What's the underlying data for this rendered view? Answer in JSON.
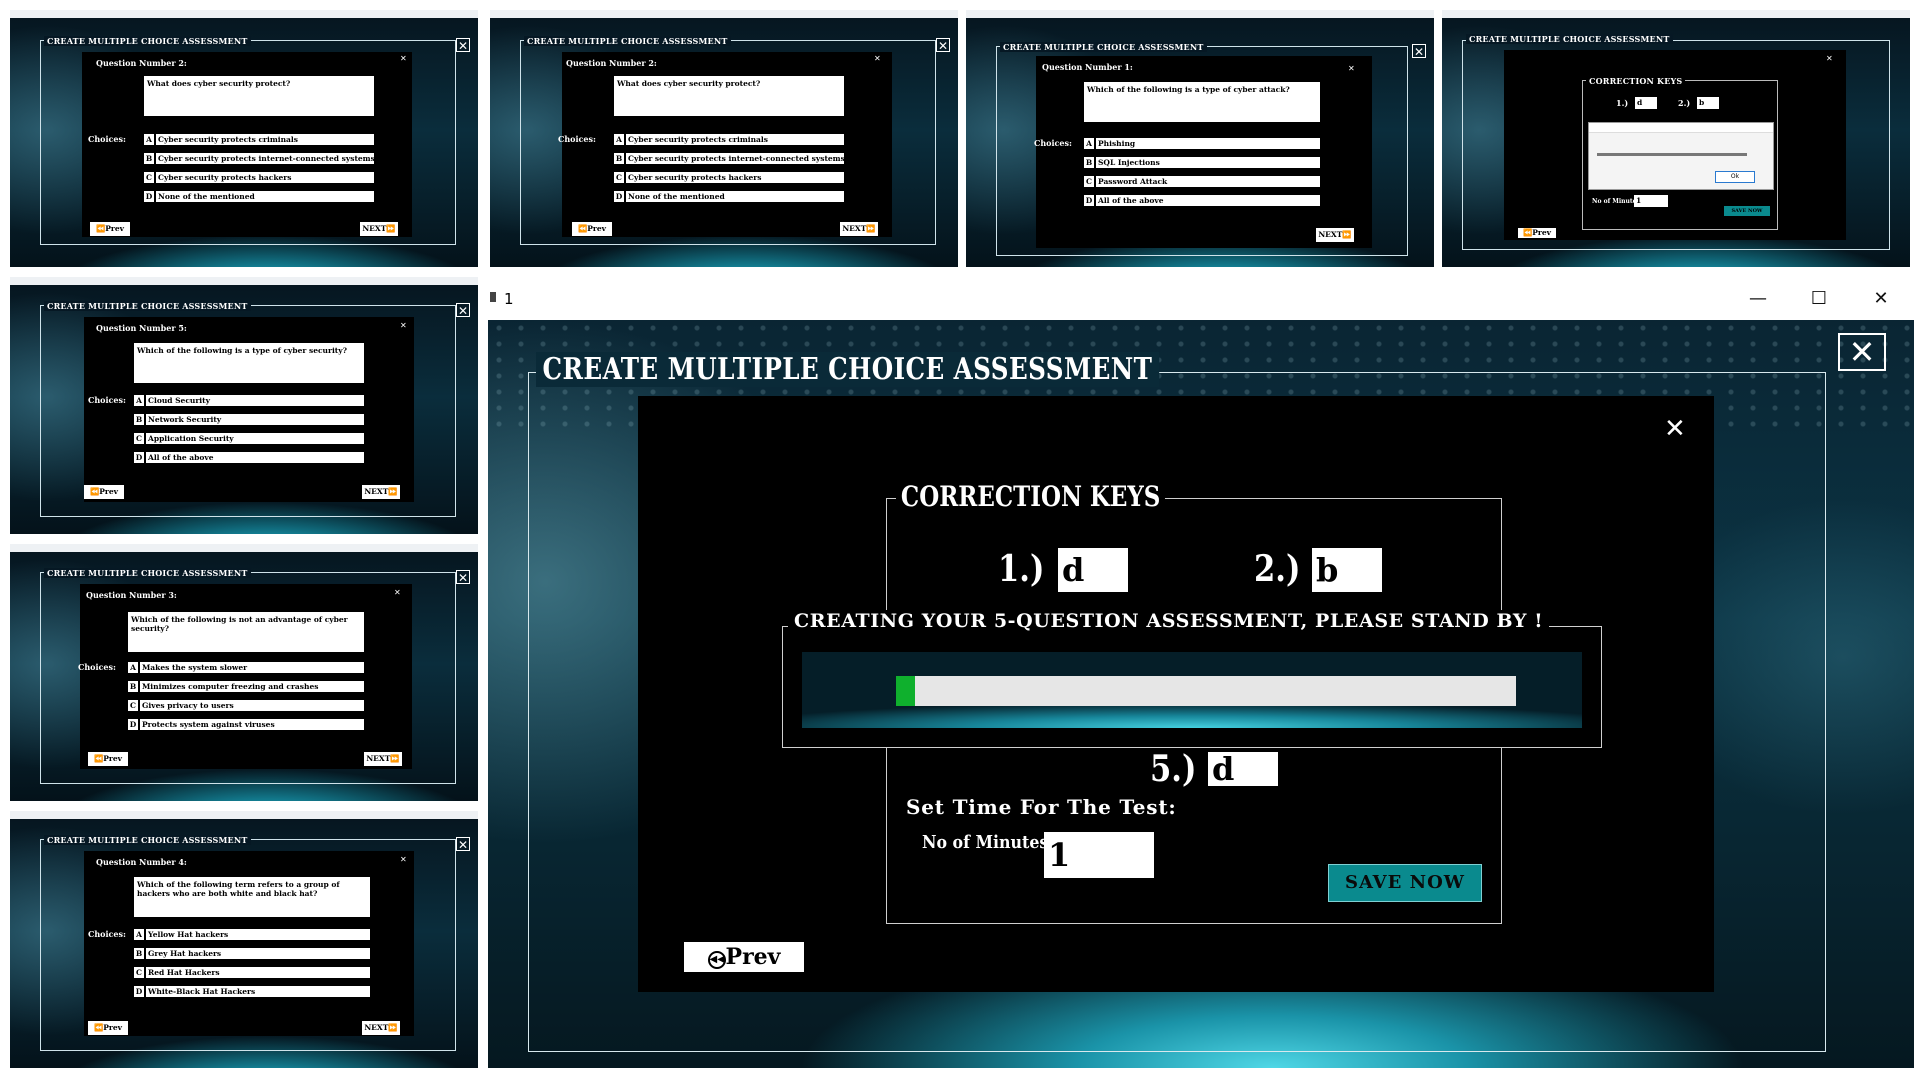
{
  "app": {
    "main_window_title": "1",
    "banner": "CREATE MULTIPLE CHOICE ASSESSMENT",
    "close_glyph": "✕"
  },
  "common": {
    "choices_label": "Choices:",
    "prev_label": "Prev",
    "next_label": "NEXT",
    "prev_icon": "rewind-icon",
    "next_icon": "fast-forward-icon"
  },
  "thumbs": [
    {
      "question_number": "Question Number 2:",
      "question": "What does cyber security protect?",
      "options": [
        {
          "letter": "A",
          "text": "Cyber security protects criminals"
        },
        {
          "letter": "B",
          "text": "Cyber security protects internet-connected systems"
        },
        {
          "letter": "C",
          "text": "Cyber security protects hackers"
        },
        {
          "letter": "D",
          "text": "None of the mentioned"
        }
      ]
    },
    {
      "question_number": "Question Number 2:",
      "question": "What does cyber security protect?",
      "options": [
        {
          "letter": "A",
          "text": "Cyber security protects criminals"
        },
        {
          "letter": "B",
          "text": "Cyber security protects internet-connected systems"
        },
        {
          "letter": "C",
          "text": "Cyber security protects hackers"
        },
        {
          "letter": "D",
          "text": "None of the mentioned"
        }
      ]
    },
    {
      "question_number": "Question Number 1:",
      "question": "Which of the following is a type of cyber attack?",
      "options": [
        {
          "letter": "A",
          "text": "Phishing"
        },
        {
          "letter": "B",
          "text": "SQL Injections"
        },
        {
          "letter": "C",
          "text": "Password Attack"
        },
        {
          "letter": "D",
          "text": "All of the above"
        }
      ]
    },
    {
      "question_number": "Question Number 5:",
      "question": "Which of the following is a type of cyber security?",
      "options": [
        {
          "letter": "A",
          "text": "Cloud Security"
        },
        {
          "letter": "B",
          "text": "Network Security"
        },
        {
          "letter": "C",
          "text": "Application Security"
        },
        {
          "letter": "D",
          "text": "All of the above"
        }
      ]
    },
    {
      "question_number": "Question Number 3:",
      "question": "Which of the following is not an advantage of cyber security?",
      "options": [
        {
          "letter": "A",
          "text": "Makes the system slower"
        },
        {
          "letter": "B",
          "text": "Minimizes computer freezing and crashes"
        },
        {
          "letter": "C",
          "text": "Gives privacy to users"
        },
        {
          "letter": "D",
          "text": "Protects system against viruses"
        }
      ]
    },
    {
      "question_number": "Question Number 4:",
      "question": "Which of the following term refers to a group of hackers who are both white and black hat?",
      "options": [
        {
          "letter": "A",
          "text": "Yellow Hat hackers"
        },
        {
          "letter": "B",
          "text": "Grey Hat hackers"
        },
        {
          "letter": "C",
          "text": "Red Hat Hackers"
        },
        {
          "letter": "D",
          "text": "White-Black Hat Hackers"
        }
      ]
    }
  ],
  "thumb4": {
    "correction_keys_label": "CORRECTION KEYS",
    "key1_label": "1.)",
    "key1_value": "d",
    "key2_label": "2.)",
    "key2_value": "b",
    "minutes_label": "No of Minutes:",
    "minutes_value": "1",
    "save_label": "SAVE NOW",
    "ok_label": "Ok"
  },
  "main": {
    "correction_keys_label": "CORRECTION KEYS",
    "keys": [
      {
        "label": "1.)",
        "value": "d"
      },
      {
        "label": "2.)",
        "value": "b"
      },
      {
        "label": "5.)",
        "value": "d"
      }
    ],
    "loading_message": "CREATING YOUR 5-QUESTION ASSESSMENT, PLEASE STAND BY !",
    "progress_fraction": 0.03,
    "progress_color": "#0fb02d",
    "set_time_label": "Set Time For The Test:",
    "minutes_label": "No of Minutes:",
    "minutes_value": "1",
    "save_label": "SAVE NOW",
    "prev_label": "Prev",
    "window_controls": {
      "minimize": "—",
      "maximize": "☐",
      "close": "✕"
    }
  },
  "colors": {
    "accent_teal": "#0a8a8e",
    "background_dark": "#041018",
    "progress_track": "#e6e6e6"
  }
}
